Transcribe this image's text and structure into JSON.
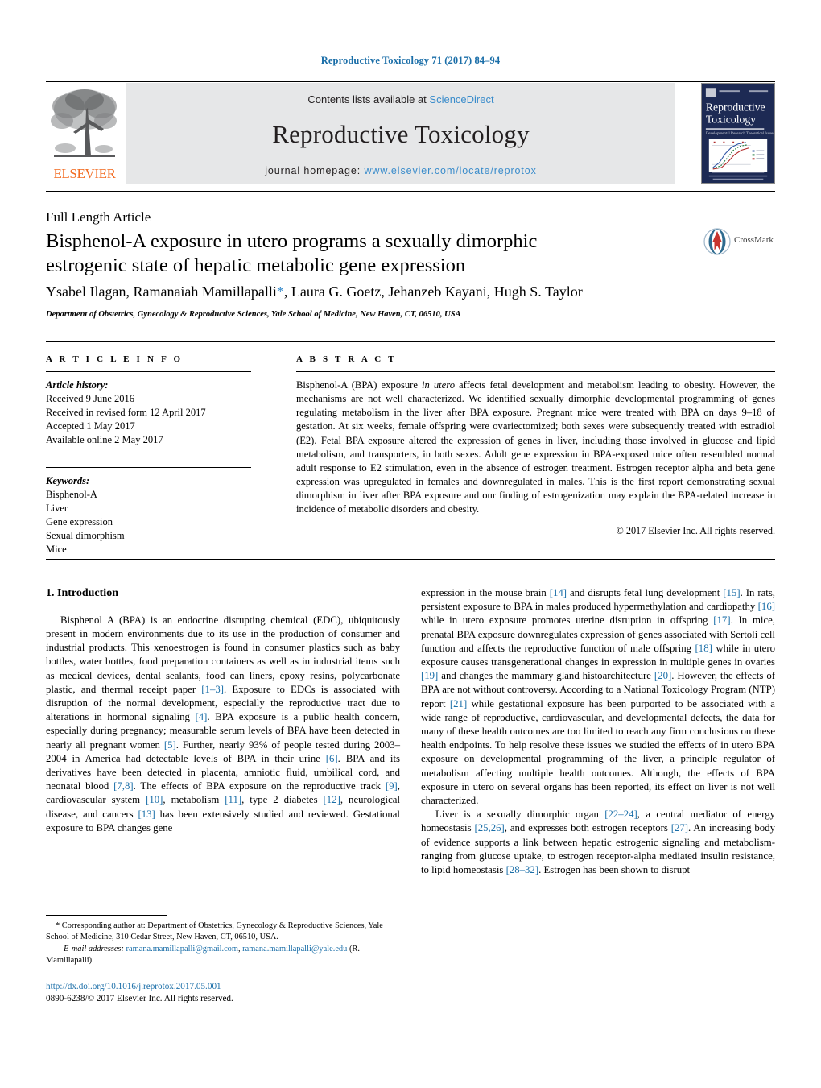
{
  "running_head": "Reproductive Toxicology 71 (2017) 84–94",
  "masthead": {
    "contents_prefix": "Contents lists available at ",
    "contents_link": "ScienceDirect",
    "journal_title": "Reproductive Toxicology",
    "homepage_prefix": "journal homepage: ",
    "homepage_url": "www.elsevier.com/locate/reprotox",
    "publisher_wordmark": "ELSEVIER",
    "cover_title_line1": "Reproductive",
    "cover_title_line2": "Toxicology",
    "cover_subtitle": "Developmental Research Theoretical Issues"
  },
  "article": {
    "type": "Full Length Article",
    "title": "Bisphenol-A exposure in utero programs a sexually dimorphic estrogenic state of hepatic metabolic gene expression",
    "authors": "Ysabel Ilagan, Ramanaiah Mamillapalli",
    "authors_rest": ", Laura G. Goetz, Jehanzeb Kayani, Hugh S. Taylor",
    "corresponding_marker": "*",
    "affiliation": "Department of Obstetrics, Gynecology & Reproductive Sciences, Yale School of Medicine, New Haven, CT, 06510, USA",
    "crossmark_label": "CrossMark"
  },
  "article_info": {
    "heading": "A R T I C L E   I N F O",
    "history_label": "Article history:",
    "history": [
      "Received 9 June 2016",
      "Received in revised form 12 April 2017",
      "Accepted 1 May 2017",
      "Available online 2 May 2017"
    ],
    "keywords_label": "Keywords:",
    "keywords": [
      "Bisphenol-A",
      "Liver",
      "Gene expression",
      "Sexual dimorphism",
      "Mice"
    ]
  },
  "abstract": {
    "heading": "A B S T R A C T",
    "part1": "Bisphenol-A (BPA) exposure ",
    "italic1": "in utero",
    "part2": " affects fetal development and metabolism leading to obesity. However, the mechanisms are not well characterized. We identified sexually dimorphic developmental programming of genes regulating metabolism in the liver after BPA exposure. Pregnant mice were treated with BPA on days 9–18 of gestation. At six weeks, female offspring were ovariectomized; both sexes were subsequently treated with estradiol (E2). Fetal BPA exposure altered the expression of genes in liver, including those involved in glucose and lipid metabolism, and transporters, in both sexes. Adult gene expression in BPA-exposed mice often resembled normal adult response to E2 stimulation, even in the absence of estrogen treatment. Estrogen receptor alpha and beta gene expression was upregulated in females and downregulated in males. This is the first report demonstrating sexual dimorphism in liver after BPA exposure and our finding of estrogenization may explain the BPA-related increase in incidence of metabolic disorders and obesity.",
    "copyright": "© 2017 Elsevier Inc. All rights reserved."
  },
  "body": {
    "section_number_title": "1. Introduction",
    "left_paragraph": [
      "Bisphenol A (BPA) is an endocrine disrupting chemical (EDC), ubiquitously present in modern environments due to its use in the production of consumer and industrial products. This xenoestrogen is found in consumer plastics such as baby bottles, water bottles, food preparation containers as well as in industrial items such as medical devices, dental sealants, food can liners, epoxy resins, polycarbonate plastic, and thermal receipt paper ",
      "[1–3]",
      ". Exposure to EDCs is associated with disruption of the normal development, especially the reproductive tract due to alterations in hormonal signaling ",
      "[4]",
      ". BPA exposure is a public health concern, especially during pregnancy; measurable serum levels of BPA have been detected in nearly all pregnant women ",
      "[5]",
      ". Further, nearly 93% of people tested during 2003–2004 in America had detectable levels of BPA in their urine ",
      "[6]",
      ". BPA and its derivatives have been detected in placenta, amniotic fluid, umbilical cord, and neonatal blood ",
      "[7,8]",
      ". The effects of BPA exposure on the reproductive track ",
      "[9]",
      ", cardiovascular system ",
      "[10]",
      ", metabolism ",
      "[11]",
      ", type 2 diabetes ",
      "[12]",
      ", neurological disease, and cancers ",
      "[13]",
      " has been extensively studied and reviewed. Gestational exposure to BPA changes gene"
    ],
    "right_paragraph_1": [
      "expression in the mouse brain ",
      "[14]",
      " and disrupts fetal lung development ",
      "[15]",
      ". In rats, persistent exposure to BPA in males produced hypermethylation and cardiopathy ",
      "[16]",
      " while in utero exposure promotes uterine disruption in offspring ",
      "[17]",
      ". In mice, prenatal BPA exposure downregulates expression of genes associated with Sertoli cell function and affects the reproductive function of male offspring ",
      "[18]",
      " while in utero exposure causes transgenerational changes in expression in multiple genes in ovaries ",
      "[19]",
      " and changes the mammary gland histoarchitecture ",
      "[20]",
      ". However, the effects of BPA are not without controversy. According to a National Toxicology Program (NTP) report ",
      "[21]",
      " while gestational exposure has been purported to be associated with a wide range of reproductive, cardiovascular, and developmental defects, the data for many of these health outcomes are too limited to reach any firm conclusions on these health endpoints. To help resolve these issues we studied the effects of in utero BPA exposure on developmental programming of the liver, a principle regulator of metabolism affecting multiple health outcomes. Although, the effects of BPA exposure in utero on several organs has been reported, its effect on liver is not well characterized."
    ],
    "right_paragraph_2": [
      "Liver is a sexually dimorphic organ ",
      "[22–24]",
      ", a central mediator of energy homeostasis ",
      "[25,26]",
      ", and expresses both estrogen receptors ",
      "[27]",
      ". An increasing body of evidence supports a link between hepatic estrogenic signaling and metabolism-ranging from glucose uptake, to estrogen receptor-alpha mediated insulin resistance, to lipid homeostasis ",
      "[28–32]",
      ". Estrogen has been shown to disrupt"
    ]
  },
  "footnotes": {
    "corresponding": "* Corresponding author at: Department of Obstetrics, Gynecology & Reproductive Sciences, Yale School of Medicine, 310 Cedar Street, New Haven, CT, 06510, USA.",
    "email_label": "E-mail addresses:",
    "email1": "ramana.mamillapalli@gmail.com",
    "email2": "ramana.mamillapalli@yale.edu",
    "email_owner": "(R. Mamillapalli).",
    "doi": "http://dx.doi.org/10.1016/j.reprotox.2017.05.001",
    "issn_line": "0890-6238/© 2017 Elsevier Inc. All rights reserved."
  },
  "colors": {
    "link_blue": "#1a6ea8",
    "sciencedirect_blue": "#3a8ccb",
    "elsevier_orange": "#f26b21",
    "masthead_gray": "#e6e7e8",
    "cover_navy": "#1d2a54"
  }
}
